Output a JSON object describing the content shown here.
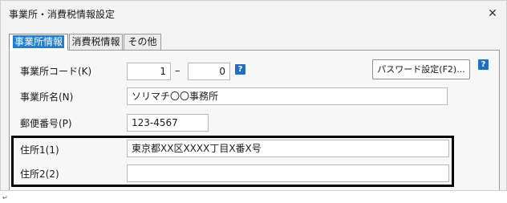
{
  "window": {
    "title": "事業所・消費税情報設定",
    "close_glyph": "✕"
  },
  "tabs": [
    {
      "label": "事業所情報",
      "active": true
    },
    {
      "label": "消費税情報",
      "active": false
    },
    {
      "label": "その他",
      "active": false
    }
  ],
  "form": {
    "office_code": {
      "label": "事業所コード(K)",
      "from_value": "1",
      "separator": "–",
      "to_value": "0"
    },
    "office_name": {
      "label": "事業所名(N)",
      "value": "ソリマチ〇〇事務所"
    },
    "postal_code": {
      "label": "郵便番号(P)",
      "value": "123-4567"
    },
    "address1": {
      "label": "住所1(1)",
      "value": "東京都XX区XXXX丁目X番X号"
    },
    "address2": {
      "label": "住所2(2)",
      "value": ""
    }
  },
  "password_button": {
    "label": "パスワード設定(F2)..."
  },
  "help_icon_glyph": "?",
  "return_mark": "↵",
  "colors": {
    "active_tab_highlight": "#1a7dd6",
    "help_icon": "#1f6fc8",
    "highlight_border": "#000000"
  }
}
